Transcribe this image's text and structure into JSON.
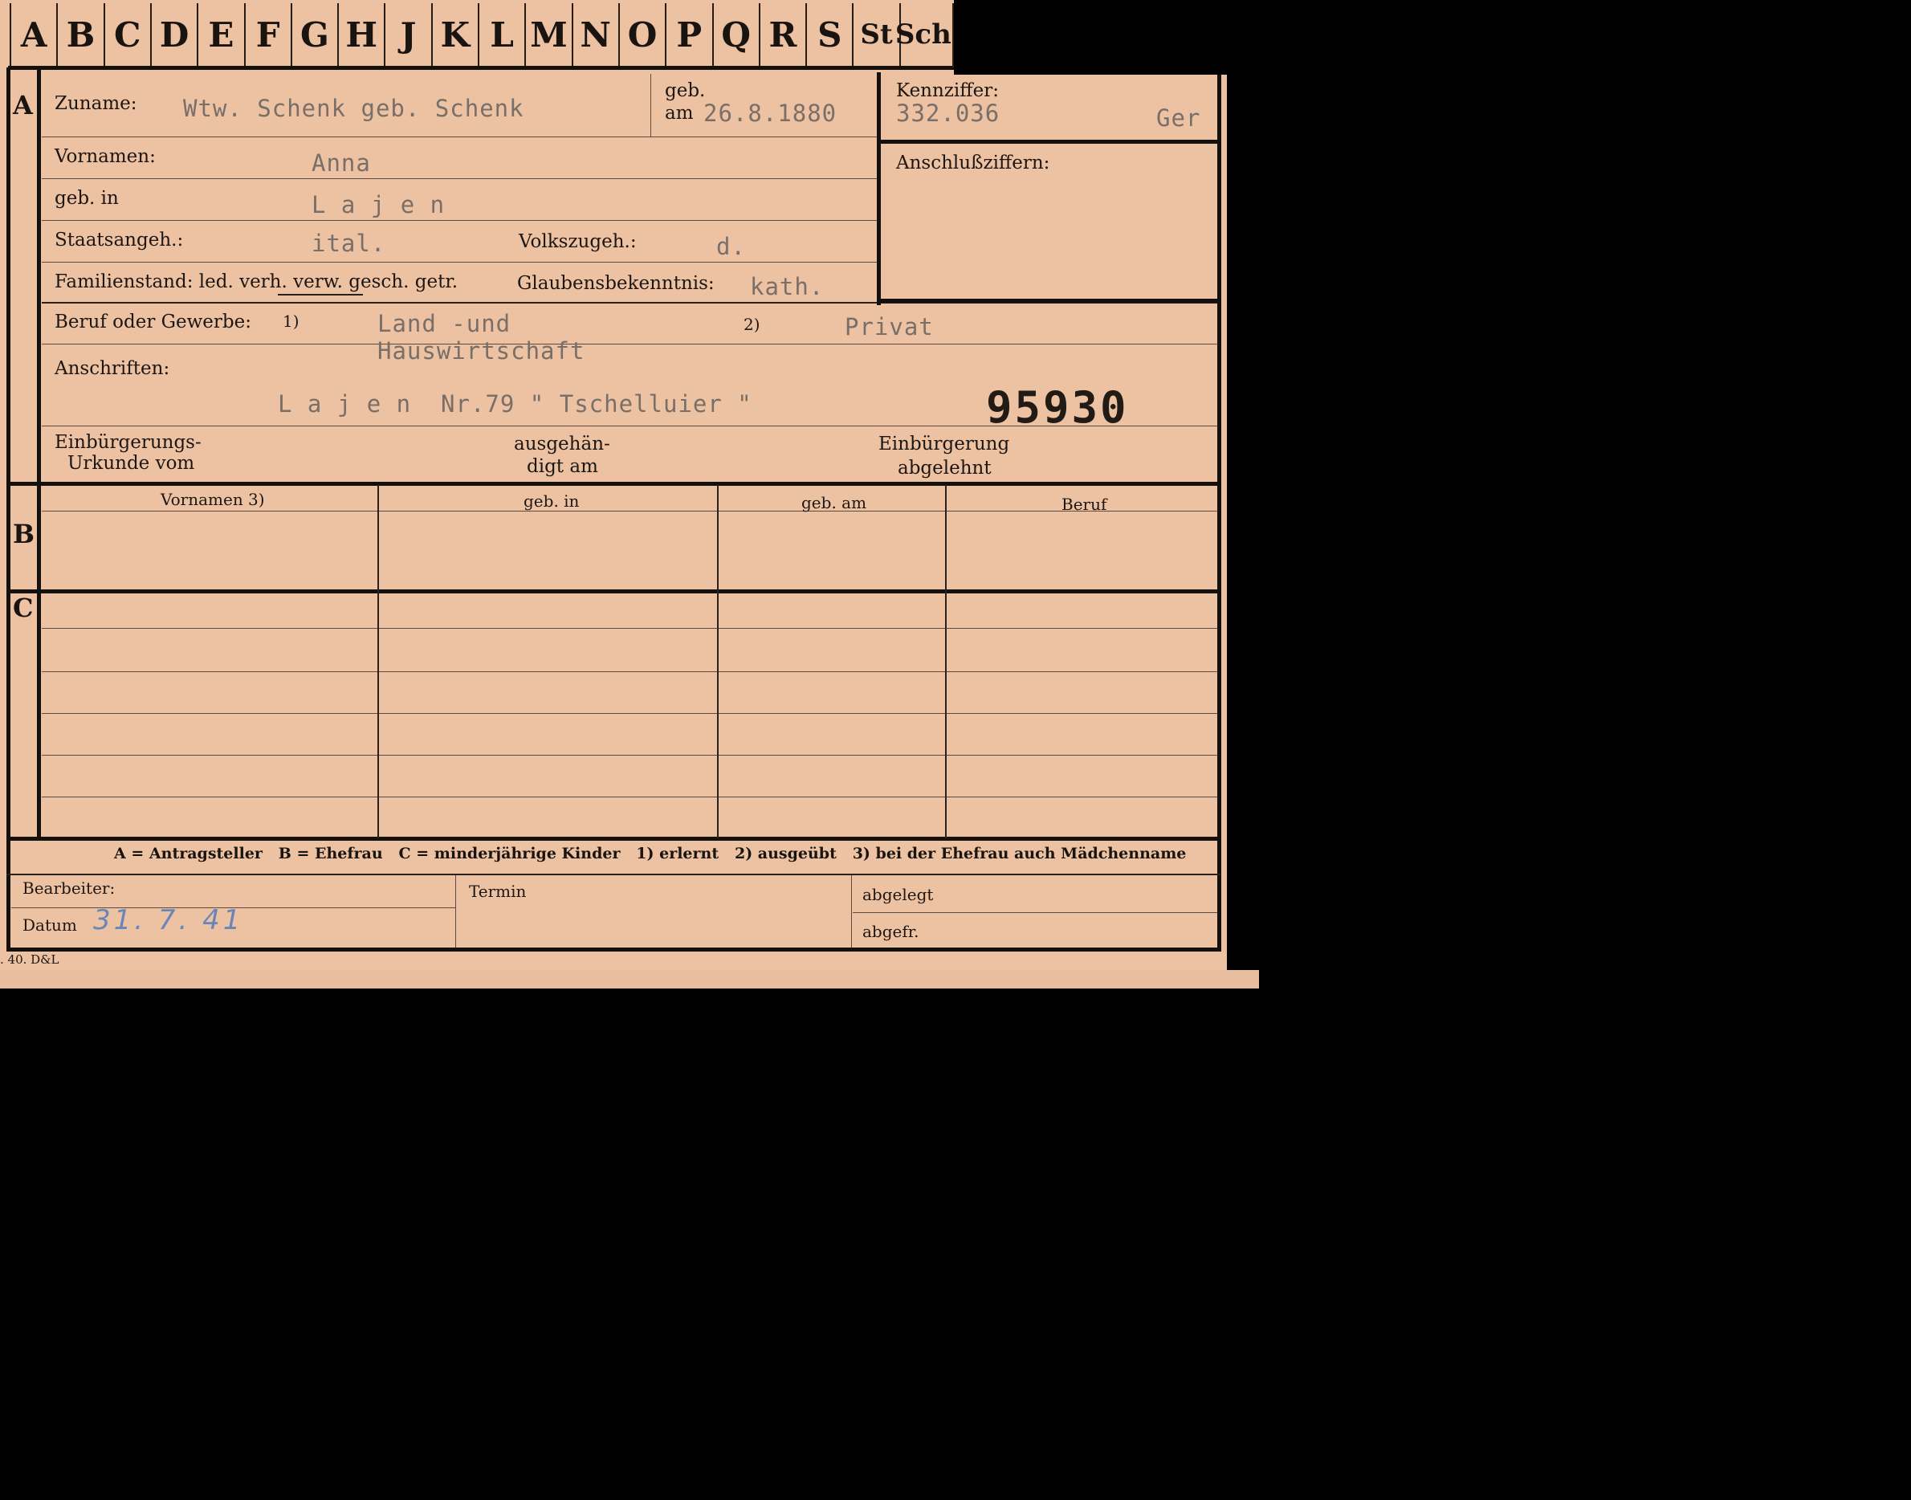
{
  "tabs": [
    "A",
    "B",
    "C",
    "D",
    "E",
    "F",
    "G",
    "H",
    "J",
    "K",
    "L",
    "M",
    "N",
    "O",
    "P",
    "Q",
    "R",
    "S",
    "St",
    "Sch"
  ],
  "rows": {
    "a": "A",
    "b": "B",
    "c": "C"
  },
  "zuname": {
    "label": "Zuname:",
    "value": "Wtw. Schenk geb. Schenk"
  },
  "geb": {
    "label1": "geb.",
    "label2": "am",
    "value": "26.8.1880"
  },
  "kennziffer": {
    "label": "Kennziffer:",
    "value": "332.036",
    "suffix": "Ger"
  },
  "anschlussziffern": {
    "label": "Anschlußziffern:"
  },
  "vornamen": {
    "label": "Vornamen:",
    "value": "Anna"
  },
  "geb_in": {
    "label": "geb. in",
    "value": "L a j e n"
  },
  "staatsangeh": {
    "label": "Staatsangeh.:",
    "value": "ital."
  },
  "volkszugeh": {
    "label": "Volkszugeh.:",
    "value": "d."
  },
  "familienstand": {
    "label": "Familienstand: led. verh. verw. gesch. getr."
  },
  "glaubensbekenntnis": {
    "label": "Glaubensbekenntnis:",
    "value": "kath."
  },
  "beruf": {
    "label": "Beruf oder Gewerbe:",
    "mark1": "1)",
    "value1a": "Land -und",
    "value1b": "Hauswirtschaft",
    "mark2": "2)",
    "value2": "Privat"
  },
  "anschriften": {
    "label": "Anschriften:",
    "value": "L a j e n  Nr.79 \" Tschelluier \"",
    "number": "95930"
  },
  "einbuergerung": {
    "urkunde1": "Einbürgerungs-",
    "urkunde2": "Urkunde vom",
    "ausgehaen1": "ausgehän-",
    "ausgehaen2": "digt am",
    "abgelehnt1": "Einbürgerung",
    "abgelehnt2": "abgelehnt"
  },
  "table_headers": [
    "Vornamen 3)",
    "geb. in",
    "geb. am",
    "Beruf"
  ],
  "legend": "A = Antragsteller   B = Ehefrau   C = minderjährige Kinder   1) erlernt   2) ausgeübt   3) bei der Ehefrau auch Mädchenname",
  "footer": {
    "bearbeiter": "Bearbeiter:",
    "datum": "Datum",
    "datum_value": "31. 7. 41",
    "termin": "Termin",
    "abgelegt": "abgelegt",
    "abgefr": "abgefr.",
    "print_mark": ". 40. D&L"
  }
}
